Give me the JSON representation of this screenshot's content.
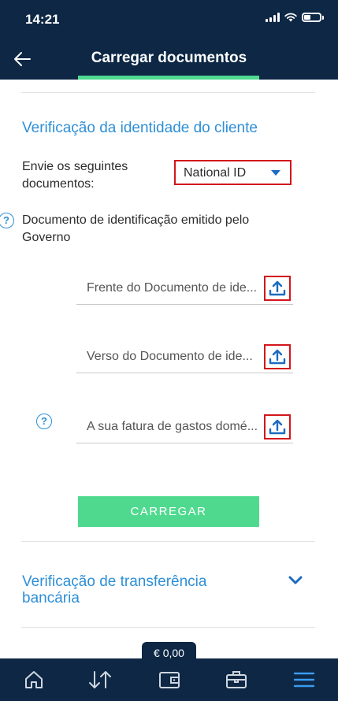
{
  "status_bar": {
    "time": "14:21"
  },
  "header": {
    "title": "Carregar documentos",
    "back_icon": "arrow-left-icon"
  },
  "identity_section": {
    "title": "Verificação da identidade do cliente",
    "send_label": "Envie os seguintes documentos:",
    "document_type_selected": "National ID",
    "doc_description": "Documento de identificação emitido pelo Governo",
    "uploads": [
      {
        "placeholder": "Frente do Documento de identificação emitido pelo Governo",
        "display": "Frente do Documento de ide..."
      },
      {
        "placeholder": "Verso do Documento de identificação emitido pelo Governo",
        "display": "Verso do Documento de ide..."
      },
      {
        "placeholder": "A sua fatura de gastos domésticos",
        "display": "A sua fatura de gastos domé..."
      }
    ],
    "submit_label": "CARREGAR"
  },
  "transfer_section": {
    "title": "Verificação de transferência bancária"
  },
  "footer": {
    "balance": "€ 0,00",
    "nav_icons": [
      "home-icon",
      "transfer-arrows-icon",
      "wallet-icon",
      "briefcase-icon",
      "menu-icon"
    ]
  },
  "colors": {
    "navy": "#0d2745",
    "accent_blue": "#2e8fd6",
    "green": "#4fd98f",
    "highlight_red": "#d2161b"
  }
}
